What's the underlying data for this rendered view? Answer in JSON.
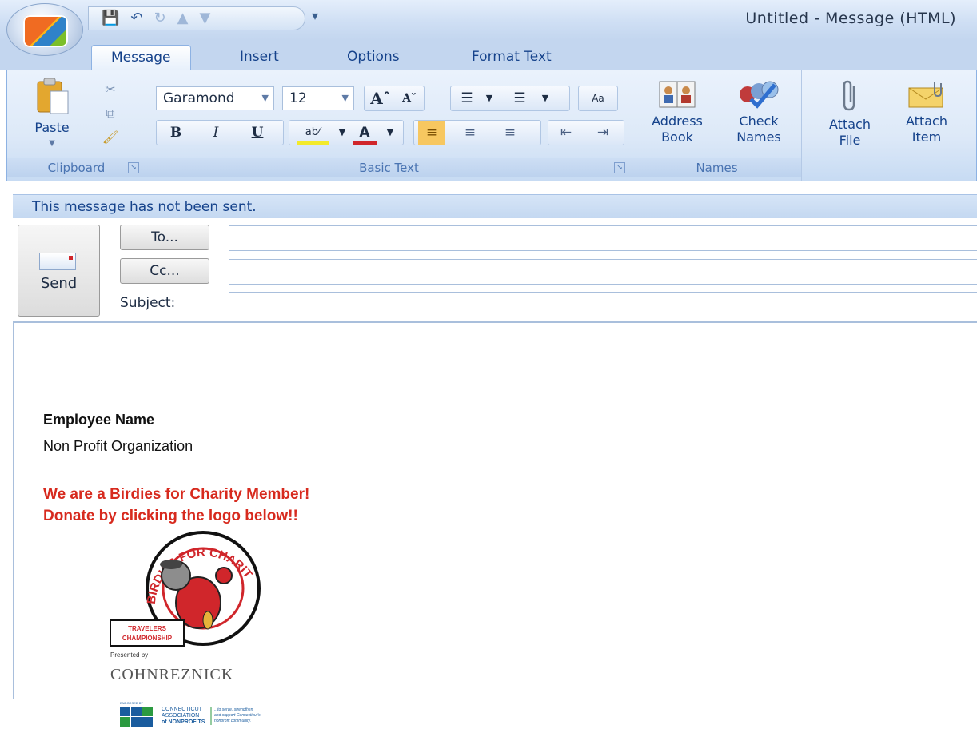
{
  "window": {
    "title": "Untitled - Message (HTML)"
  },
  "tabs": [
    "Message",
    "Insert",
    "Options",
    "Format Text"
  ],
  "ribbon": {
    "clipboard": {
      "paste_label": "Paste",
      "group_label": "Clipboard"
    },
    "basic_text": {
      "font_name": "Garamond",
      "font_size": "12",
      "bold": "B",
      "italic": "I",
      "underline": "U",
      "group_label": "Basic Text"
    },
    "names": {
      "address_book_line1": "Address",
      "address_book_line2": "Book",
      "check_names_line1": "Check",
      "check_names_line2": "Names",
      "group_label": "Names"
    },
    "include": {
      "attach_file_line1": "Attach",
      "attach_file_line2": "File",
      "attach_item_line1": "Attach",
      "attach_item_line2": "Item"
    }
  },
  "infobar": {
    "text": "This message has not been sent."
  },
  "header": {
    "send_label": "Send",
    "to_label": "To...",
    "cc_label": "Cc...",
    "subject_label": "Subject:",
    "to_value": "",
    "cc_value": "",
    "subject_value": ""
  },
  "body": {
    "employee_name": "Employee Name",
    "organization": "Non Profit Organization",
    "promo_line1": "We are a Birdies for Charity Member!",
    "promo_line2": "Donate by clicking the logo below!!"
  },
  "logo": {
    "birdies_text": "BIRDIES FOR CHARITY",
    "travelers_line1": "TRAVELERS",
    "travelers_line2": "CHAMPIONSHIP",
    "presented_by": "Presented by",
    "sponsor": "COHNREZNICK",
    "endorsed_by": "ENDORSED BY",
    "ct_line1": "CONNECTICUT",
    "ct_line2": "ASSOCIATION",
    "ct_line3": "of NONPROFITS",
    "ct_tag1": "...to serve, strengthen",
    "ct_tag2": "and support Connecticut's",
    "ct_tag3": "nonprofit community."
  },
  "colors": {
    "ribbon_blue": "#15428b",
    "promo_red": "#d72a1e",
    "logo_red": "#d0262b"
  }
}
